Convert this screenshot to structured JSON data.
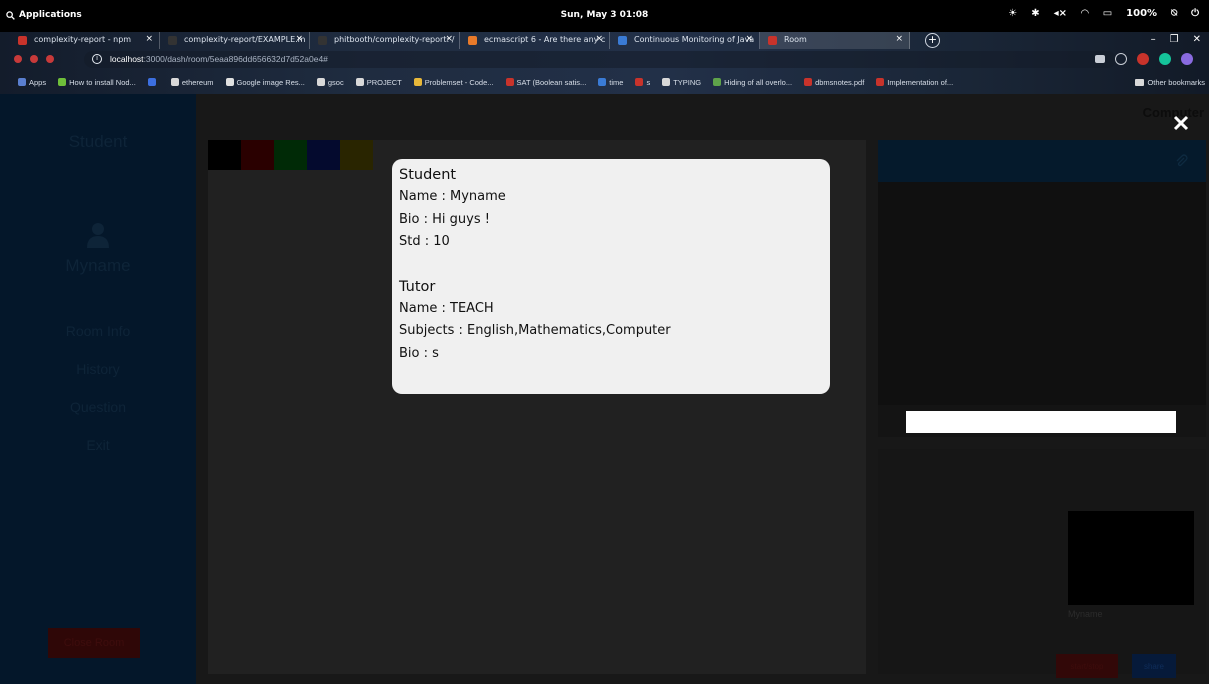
{
  "os": {
    "apps_label": "Applications",
    "clock": "Sun, May 3   01:08",
    "battery": "100%"
  },
  "browser": {
    "tabs": [
      {
        "title": "complexity-report - npm",
        "color": "#c8332b"
      },
      {
        "title": "complexity-report/EXAMPLE.m",
        "color": "#333333"
      },
      {
        "title": "phitbooth/complexity-report: /",
        "color": "#333333"
      },
      {
        "title": "ecmascript 6 - Are there any c",
        "color": "#e87a2a"
      },
      {
        "title": "Continuous Monitoring of Java",
        "color": "#3a7bd5"
      },
      {
        "title": "Room",
        "color": "#c8332b"
      }
    ],
    "url_host": "localhost",
    "url_path": ":3000/dash/room/5eaa896dd656632d7d52a0e4#",
    "bookmarks": [
      {
        "label": "Apps",
        "color": "#5a7fd0"
      },
      {
        "label": "How to install Nod...",
        "color": "#6fbf3a"
      },
      {
        "label": "",
        "color": "#3c6fe0"
      },
      {
        "label": "ethereum",
        "color": "#d9d9d9"
      },
      {
        "label": "Google image Res...",
        "color": "#e0e0e0"
      },
      {
        "label": "gsoc",
        "color": "#d9d9d9"
      },
      {
        "label": "PROJECT",
        "color": "#d9d9d9"
      },
      {
        "label": "Problemset - Code...",
        "color": "#e8b83a"
      },
      {
        "label": "SAT (Boolean satis...",
        "color": "#c8332b"
      },
      {
        "label": "time",
        "color": "#3a7bd5"
      },
      {
        "label": "s",
        "color": "#c8332b"
      },
      {
        "label": "TYPING",
        "color": "#d9d9d9"
      },
      {
        "label": "Hiding of all overlo...",
        "color": "#5fa34a"
      },
      {
        "label": "dbmsnotes.pdf",
        "color": "#c8332b"
      },
      {
        "label": "Implementation of...",
        "color": "#c8332b"
      }
    ],
    "other_bookmarks": "Other bookmarks"
  },
  "sidebar": {
    "title": "Student",
    "username": "Myname",
    "menu": [
      "Room Info",
      "History",
      "Question",
      "Exit"
    ],
    "close_room": "Close Room"
  },
  "palette": [
    "#000000",
    "#2a0000",
    "#002a06",
    "#040a2e",
    "#292500"
  ],
  "right": {
    "computer_label": "Computer",
    "video_label": "Myname",
    "start_stop": "start/stop",
    "share": "share"
  },
  "modal": {
    "student_heading": "Student",
    "student_name": "Name : Myname",
    "student_bio": "Bio : Hi guys !",
    "student_std": "Std : 10",
    "tutor_heading": "Tutor",
    "tutor_name": "Name : TEACH",
    "tutor_subjects": "Subjects : English,Mathematics,Computer",
    "tutor_bio": "Bio : s"
  }
}
